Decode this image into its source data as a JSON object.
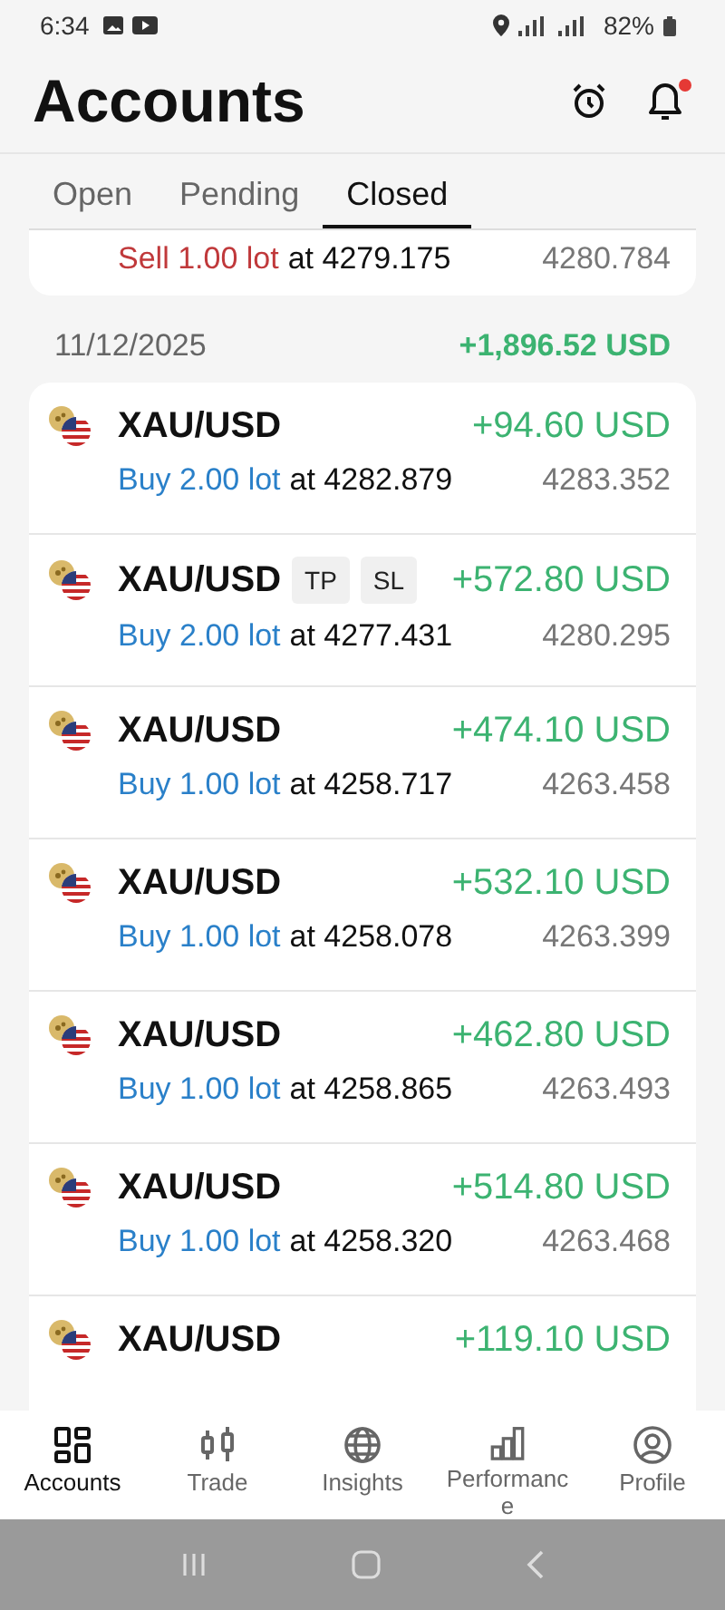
{
  "status_bar": {
    "time": "6:34",
    "battery": "82%"
  },
  "header": {
    "title": "Accounts",
    "notification_dot": true
  },
  "tabs": [
    {
      "label": "Open",
      "selected": false
    },
    {
      "label": "Pending",
      "selected": false
    },
    {
      "label": "Closed",
      "selected": true
    }
  ],
  "partial_trade": {
    "kind": "sell",
    "order": "Sell 1.00 lot",
    "at": "at 4279.175",
    "close": "4280.784"
  },
  "groups": [
    {
      "date": "11/12/2025",
      "total": "+1,896.52 USD",
      "trades": [
        {
          "symbol": "XAU/USD",
          "profit": "+94.60 USD",
          "kind": "buy",
          "order": "Buy 2.00 lot",
          "at": "at 4282.879",
          "close": "4283.352"
        },
        {
          "symbol": "XAU/USD",
          "tags": [
            "TP",
            "SL"
          ],
          "profit": "+572.80 USD",
          "kind": "buy",
          "order": "Buy 2.00 lot",
          "at": "at 4277.431",
          "close": "4280.295"
        },
        {
          "symbol": "XAU/USD",
          "profit": "+474.10 USD",
          "kind": "buy",
          "order": "Buy 1.00 lot",
          "at": "at 4258.717",
          "close": "4263.458"
        },
        {
          "symbol": "XAU/USD",
          "profit": "+532.10 USD",
          "kind": "buy",
          "order": "Buy 1.00 lot",
          "at": "at 4258.078",
          "close": "4263.399"
        },
        {
          "symbol": "XAU/USD",
          "profit": "+462.80 USD",
          "kind": "buy",
          "order": "Buy 1.00 lot",
          "at": "at 4258.865",
          "close": "4263.493"
        },
        {
          "symbol": "XAU/USD",
          "profit": "+514.80 USD",
          "kind": "buy",
          "order": "Buy 1.00 lot",
          "at": "at 4258.320",
          "close": "4263.468"
        },
        {
          "symbol": "XAU/USD",
          "profit": "+119.10 USD"
        }
      ]
    }
  ],
  "bottom_nav": [
    {
      "label": "Accounts",
      "selected": true
    },
    {
      "label": "Trade",
      "selected": false
    },
    {
      "label": "Insights",
      "selected": false
    },
    {
      "label": "Performance",
      "selected": false
    },
    {
      "label": "Profile",
      "selected": false
    }
  ]
}
